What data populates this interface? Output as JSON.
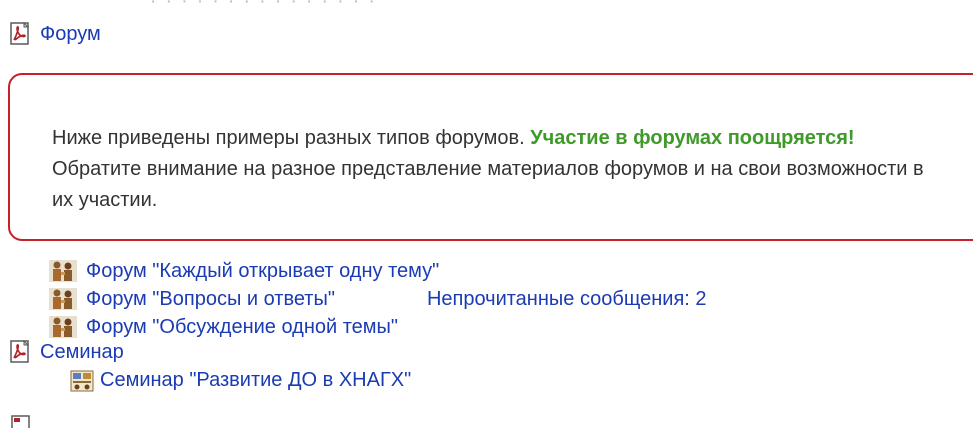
{
  "top_fragment": "· · · · ·   ·   ·  · · · ·  ·   · · ·",
  "forum_section": {
    "icon": "pdf-document-icon",
    "label": "Форум"
  },
  "intro_box": {
    "text_before": "Ниже приведены примеры разных типов форумов. ",
    "highlight": "Участие в форумах поощряется!",
    "text_after": " Обратите внимание на разное представление материалов форумов и на свои возможности в их участии.",
    "border_color": "#c8202a",
    "highlight_color": "#3f9a2a"
  },
  "forums": [
    {
      "icon": "forum-people-icon",
      "label": "Форум \"Каждый открывает одну тему\""
    },
    {
      "icon": "forum-people-icon",
      "label": "Форум \"Вопросы и ответы\"",
      "unread": "Непрочитанные сообщения: 2"
    },
    {
      "icon": "forum-people-icon",
      "label": "Форум \"Обсуждение одной темы\""
    }
  ],
  "seminar_section": {
    "icon": "pdf-document-icon",
    "label": "Семинар"
  },
  "seminars": [
    {
      "icon": "seminar-icon",
      "label": "Семинар \"Развитие ДО в ХНАГХ\""
    }
  ],
  "colors": {
    "link": "#1a3bb3",
    "text": "#333333"
  }
}
